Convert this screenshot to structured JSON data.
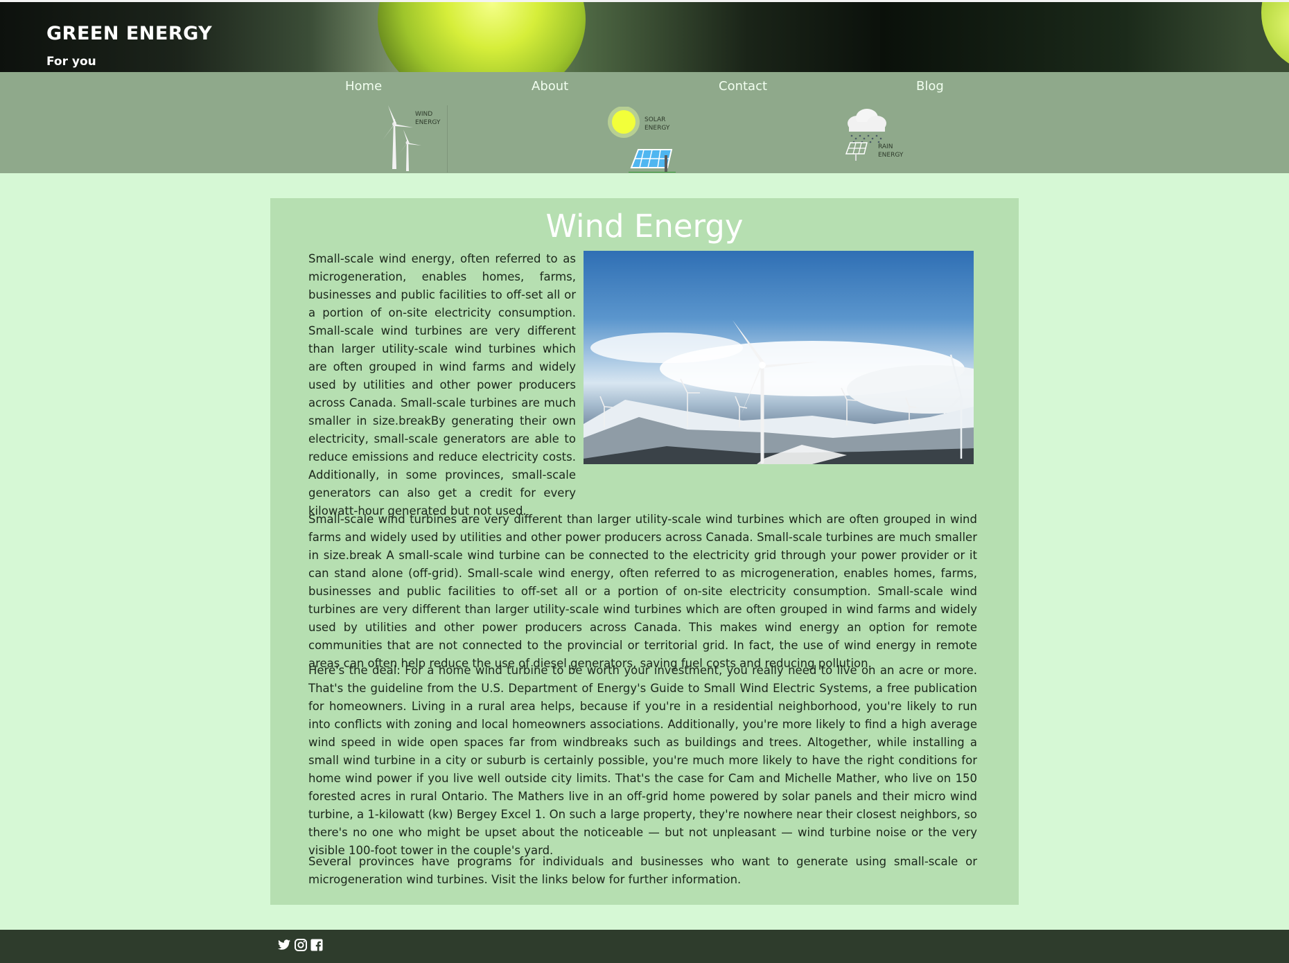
{
  "colors": {
    "page_bg": "#d6f8d5",
    "nav_bg": "#8fa98b",
    "card_bg": "#b6dfb1",
    "footer_bg": "#2e3c2c",
    "accent_sun": "#f2ff3a"
  },
  "header": {
    "title": "GREEN ENERGY",
    "tagline": "For you"
  },
  "nav": {
    "links": [
      {
        "label": "Home"
      },
      {
        "label": "About"
      },
      {
        "label": "Contact"
      },
      {
        "label": "Blog"
      }
    ],
    "energy_icons": [
      {
        "icon": "wind-turbine-icon",
        "line1": "WIND",
        "line2": "ENERGY"
      },
      {
        "icon": "solar-panel-icon",
        "line1": "SOLAR",
        "line2": "ENERGY"
      },
      {
        "icon": "rain-cloud-icon",
        "line1": "RAIN",
        "line2": "ENERGY"
      }
    ]
  },
  "article": {
    "title": "Wind Energy",
    "image_icon": "wind-farm-photo",
    "paragraphs": [
      "Small-scale wind energy, often referred to as microgeneration, enables homes, farms, businesses and public facilities to off-set all or a portion of on-site electricity consumption. Small-scale wind turbines are very different than larger utility-scale wind turbines which are often grouped in wind farms and widely used by utilities and other power producers across Canada. Small-scale turbines are much smaller in size.breakBy generating their own electricity, small-scale generators are able to reduce emissions and reduce electricity costs. Additionally, in some provinces, small-scale generators can also get a credit for every kilowatt-hour generated but not used.",
      "Small-scale wind turbines are very different than larger utility-scale wind turbines which are often grouped in wind farms and widely used by utilities and other power producers across Canada. Small-scale turbines are much smaller in size.break A small-scale wind turbine can be connected to the electricity grid through your power provider or it can stand alone (off-grid). Small-scale wind energy, often referred to as microgeneration, enables homes, farms, businesses and public facilities to off-set all or a portion of on-site electricity consumption. Small-scale wind turbines are very different than larger utility-scale wind turbines which are often grouped in wind farms and widely used by utilities and other power producers across Canada. This makes wind energy an option for remote communities that are not connected to the provincial or territorial grid. In fact, the use of wind energy in remote areas can often help reduce the use of diesel generators, saving fuel costs and reducing pollution.",
      "Here's the deal: For a home wind turbine to be worth your investment, you really need to live on an acre or more. That's the guideline from the U.S. Department of Energy's Guide to Small Wind Electric Systems, a free publication for homeowners. Living in a rural area helps, because if you're in a residential neighborhood, you're likely to run into conflicts with zoning and local homeowners associations. Additionally, you're more likely to find a high average wind speed in wide open spaces far from windbreaks such as buildings and trees. Altogether, while installing a small wind turbine in a city or suburb is certainly possible, you're much more likely to have the right conditions for home wind power if you live well outside city limits. That's the case for Cam and Michelle Mather, who live on 150 forested acres in rural Ontario. The Mathers live in an off-grid home powered by solar panels and their micro wind turbine, a 1-kilowatt (kw) Bergey Excel 1. On such a large property, they're nowhere near their closest neighbors, so there's no one who might be upset about the noticeable — but not unpleasant — wind turbine noise or the very visible 100-foot tower in the couple's yard.",
      "Several provinces have programs for individuals and businesses who want to generate using small-scale or microgeneration wind turbines. Visit the links below for further information."
    ]
  },
  "footer": {
    "social_icons": [
      "twitter-icon",
      "instagram-icon",
      "facebook-icon"
    ]
  }
}
